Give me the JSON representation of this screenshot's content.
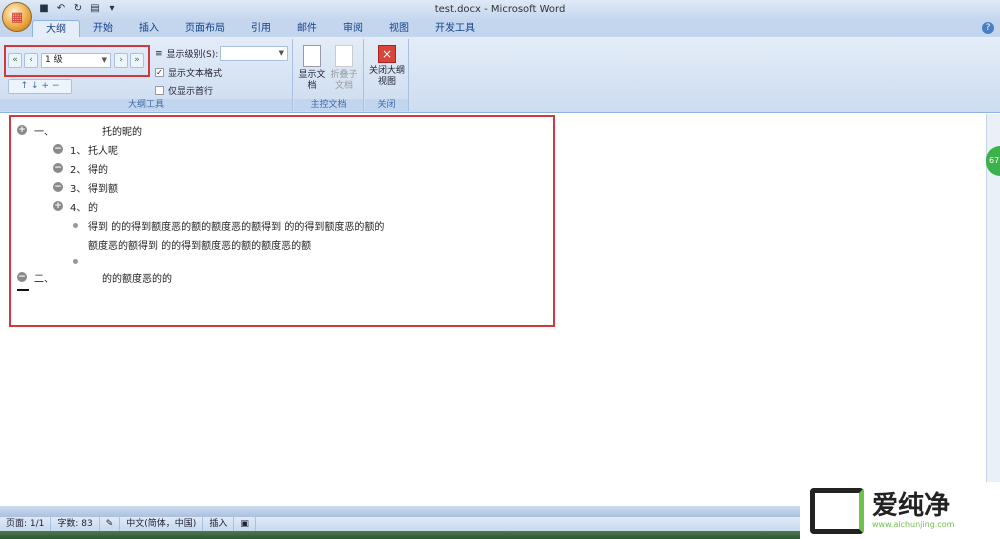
{
  "window": {
    "title": "test.docx - Microsoft Word"
  },
  "tabs": [
    "大纲",
    "开始",
    "插入",
    "页面布局",
    "引用",
    "邮件",
    "审阅",
    "视图",
    "开发工具"
  ],
  "ribbon": {
    "outline_tools": {
      "level_value": "1 级",
      "show_level_label": "显示级别(S):",
      "show_text_format": "显示文本格式",
      "show_first_line": "仅显示首行",
      "group_label": "大纲工具"
    },
    "master_doc": {
      "show_doc": "显示文档",
      "collapse_sub": "折叠子文档",
      "group_label": "主控文档"
    },
    "close": {
      "close_outline": "关闭大纲视图",
      "group_label": "关闭"
    }
  },
  "outline": [
    {
      "level": 0,
      "symbol": "plus",
      "number": "一、",
      "text": "托的昵的"
    },
    {
      "level": 1,
      "symbol": "minus",
      "number": "1、",
      "text": "托人呢"
    },
    {
      "level": 1,
      "symbol": "minus",
      "number": "2、",
      "text": "得的"
    },
    {
      "level": 1,
      "symbol": "minus",
      "number": "3、",
      "text": "得到额"
    },
    {
      "level": 1,
      "symbol": "plus",
      "number": "4、",
      "text": "的"
    },
    {
      "level": 2,
      "symbol": "dot",
      "number": "",
      "text": "得到 的的得到额度恶的额的额度恶的额得到 的的得到额度恶的额的"
    },
    {
      "level": 2,
      "symbol": "none",
      "number": "",
      "text": "额度恶的额得到 的的得到额度恶的额的额度恶的额"
    },
    {
      "level": 2,
      "symbol": "dot",
      "number": "",
      "text": ""
    },
    {
      "level": 0,
      "symbol": "minus",
      "number": "二、",
      "text": "的的额度恶的的"
    }
  ],
  "status": {
    "page": "页面: 1/1",
    "words": "字数: 83",
    "language": "中文(简体，中国)",
    "mode": "插入"
  },
  "side_badge": "67",
  "watermark": {
    "text": "爱纯净",
    "url": "www.aichunjing.com"
  }
}
